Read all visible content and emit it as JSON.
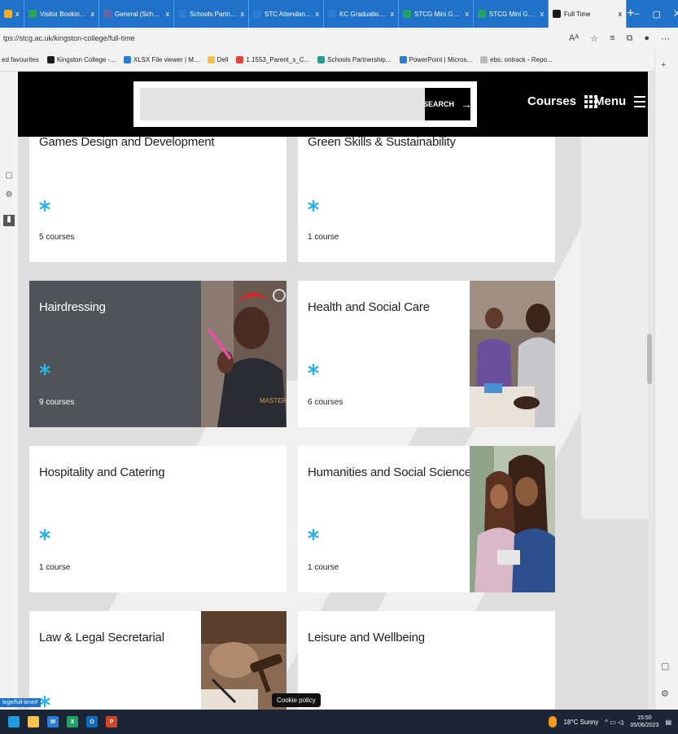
{
  "browser": {
    "tabs": [
      {
        "label": "",
        "color": "#f2b01e"
      },
      {
        "label": "Visitor Booking Form",
        "color": "#2aa35b"
      },
      {
        "label": "General (Schools Parti...",
        "color": "#6264a7"
      },
      {
        "label": "Schools Partnership -",
        "color": "#2b7cd3"
      },
      {
        "label": "STC Attendance Certif...",
        "color": "#2b7cd3"
      },
      {
        "label": "KC Graduation Certifi...",
        "color": "#2b7cd3"
      },
      {
        "label": "STCG Mini Guide Ma...",
        "color": "#21a366"
      },
      {
        "label": "STCG Mini Guide Ma...",
        "color": "#21a366"
      },
      {
        "label": "Full Time",
        "color": "#1a1a1a",
        "active": true
      }
    ],
    "new_tab": "+",
    "window_controls": [
      "–",
      "▢",
      "X"
    ],
    "url": "tps://stcg.ac.uk/kingston-college/full-time",
    "favourites": [
      {
        "label": "ed favourites",
        "color": "#f3f3f3"
      },
      {
        "label": "Kingston College -...",
        "color": "#1a1a1a"
      },
      {
        "label": "XLSX File viewer | M...",
        "color": "#2b7cd3"
      },
      {
        "label": "Dell",
        "color": "#f2c14e"
      },
      {
        "label": "1.1553_Parent_s_C...",
        "color": "#e0453a"
      },
      {
        "label": "Schools Partnership...",
        "color": "#2a9d8f"
      },
      {
        "label": "PowerPoint | Micros...",
        "color": "#2b7cd3"
      },
      {
        "label": "ebs: ontrack - Repo...",
        "color": "#bbbbbb"
      }
    ]
  },
  "header": {
    "search_placeholder": "",
    "search_button": "SEARCH",
    "courses_label": "Courses",
    "menu_label": "Menu"
  },
  "courses": [
    {
      "title": "Games Design and Development",
      "count": "5 courses"
    },
    {
      "title": "Green Skills & Sustainability",
      "count": "1 course"
    },
    {
      "title": "Hairdressing",
      "count": "9 courses"
    },
    {
      "title": "Health and Social Care",
      "count": "6 courses"
    },
    {
      "title": "Hospitality and Catering",
      "count": "1 course"
    },
    {
      "title": "Humanities and Social Sciences",
      "count": "1 course"
    },
    {
      "title": "Law & Legal Secretarial",
      "count": ""
    },
    {
      "title": "Leisure and Wellbeing",
      "count": ""
    }
  ],
  "accent_color": "#2bb3e6",
  "status_link": "lege/full-time#",
  "cookie_label": "Cookie policy",
  "taskbar": {
    "apps": [
      {
        "label": "",
        "color": "#1c9be0"
      },
      {
        "label": "",
        "color": "#f2c14e"
      },
      {
        "label": "W",
        "color": "#2b7cd3"
      },
      {
        "label": "X",
        "color": "#21a366"
      },
      {
        "label": "O",
        "color": "#0f6cbd"
      },
      {
        "label": "P",
        "color": "#d24726"
      }
    ],
    "weather": "18°C Sunny",
    "time": "15:50",
    "date": "05/06/2023"
  }
}
